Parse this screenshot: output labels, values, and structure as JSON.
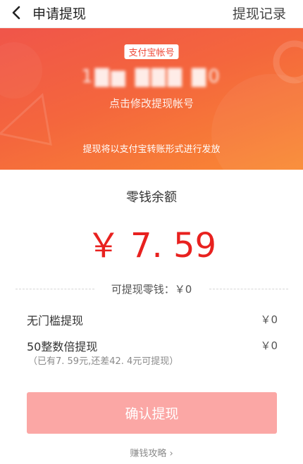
{
  "header": {
    "title": "申请提现",
    "records_label": "提现记录",
    "back_icon": "chevron-left-icon"
  },
  "account": {
    "type_label": "支付宝帐号",
    "number_masked": "1▇▆ ▇▇▇ ▇0",
    "edit_label": "点击修改提现帐号",
    "notice": "提现将以支付宝转账形式进行发放"
  },
  "balance": {
    "label": "零钱余额",
    "currency": "￥",
    "amount": "7. 59"
  },
  "available": {
    "text": "可提现零钱：￥0"
  },
  "options": [
    {
      "label": "无门槛提现",
      "value": "￥0"
    },
    {
      "label": "50整数倍提现",
      "value": "￥0",
      "note": "（已有7. 59元,还差42. 4元可提现）"
    }
  ],
  "confirm_label": "确认提现",
  "guide_label": "赚钱攻略 ›",
  "colors": {
    "accent_red": "#e8211f",
    "banner_start": "#f0554a",
    "banner_end": "#f98a33",
    "button_disabled": "#fba7a5"
  }
}
